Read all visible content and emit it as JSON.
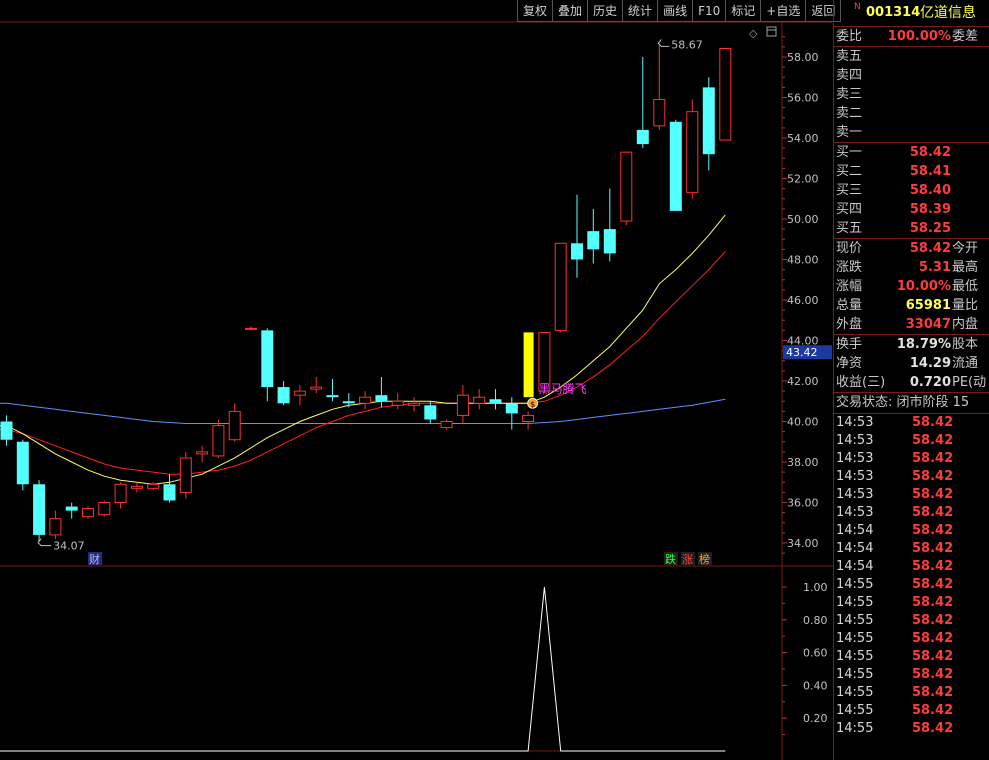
{
  "toolbar": {
    "buttons": [
      "复权",
      "叠加",
      "历史",
      "统计",
      "画线",
      "F10",
      "标记",
      "+自选",
      "返回"
    ]
  },
  "stock": {
    "code": "001314",
    "name": "亿道信息",
    "badge": "N"
  },
  "quote": {
    "weibi_label": "委比",
    "weibi_value": "100.00%",
    "weicha_label": "委差",
    "sell": [
      {
        "label": "卖五",
        "price": ""
      },
      {
        "label": "卖四",
        "price": ""
      },
      {
        "label": "卖三",
        "price": ""
      },
      {
        "label": "卖二",
        "price": ""
      },
      {
        "label": "卖一",
        "price": ""
      }
    ],
    "buy": [
      {
        "label": "买一",
        "price": "58.42"
      },
      {
        "label": "买二",
        "price": "58.41"
      },
      {
        "label": "买三",
        "price": "58.40"
      },
      {
        "label": "买四",
        "price": "58.39"
      },
      {
        "label": "买五",
        "price": "58.25"
      }
    ],
    "stats1": [
      {
        "label": "现价",
        "value": "58.42",
        "label2": "今开",
        "color": "red"
      },
      {
        "label": "涨跌",
        "value": "5.31",
        "label2": "最高",
        "color": "red"
      },
      {
        "label": "涨幅",
        "value": "10.00%",
        "label2": "最低",
        "color": "red"
      },
      {
        "label": "总量",
        "value": "65981",
        "label2": "量比",
        "color": "yellow"
      },
      {
        "label": "外盘",
        "value": "33047",
        "label2": "内盘",
        "color": "red"
      }
    ],
    "stats2": [
      {
        "label": "换手",
        "value": "18.79%",
        "label2": "股本",
        "color": "white"
      },
      {
        "label": "净资",
        "value": "14.29",
        "label2": "流通",
        "color": "white"
      },
      {
        "label": "收益(三)",
        "value": "0.720",
        "label2": "PE(动",
        "color": "white"
      }
    ],
    "trade_status": "交易状态: 闭市阶段 15"
  },
  "ticks": [
    {
      "time": "14:53",
      "price": "58.42"
    },
    {
      "time": "14:53",
      "price": "58.42"
    },
    {
      "time": "14:53",
      "price": "58.42"
    },
    {
      "time": "14:53",
      "price": "58.42"
    },
    {
      "time": "14:53",
      "price": "58.42"
    },
    {
      "time": "14:53",
      "price": "58.42"
    },
    {
      "time": "14:54",
      "price": "58.42"
    },
    {
      "time": "14:54",
      "price": "58.42"
    },
    {
      "time": "14:54",
      "price": "58.42"
    },
    {
      "time": "14:55",
      "price": "58.42"
    },
    {
      "time": "14:55",
      "price": "58.42"
    },
    {
      "time": "14:55",
      "price": "58.42"
    },
    {
      "time": "14:55",
      "price": "58.42"
    },
    {
      "time": "14:55",
      "price": "58.42"
    },
    {
      "time": "14:55",
      "price": "58.42"
    },
    {
      "time": "14:55",
      "price": "58.42"
    },
    {
      "time": "14:55",
      "price": "58.42"
    },
    {
      "time": "14:55",
      "price": "58.42"
    }
  ],
  "chart_data": {
    "type": "candlestick",
    "ylim": [
      33.0,
      59.5
    ],
    "y_ticks": [
      "58.00",
      "56.00",
      "54.00",
      "52.00",
      "50.00",
      "48.00",
      "46.00",
      "44.00",
      "42.00",
      "40.00",
      "38.00",
      "36.00",
      "34.00"
    ],
    "current_price_tag": "43.42",
    "high_marker": "58.67",
    "low_marker": "34.07",
    "signal_label": "黑马腾飞",
    "signal_coin": "$",
    "tags": {
      "left": "财",
      "right": [
        "跌",
        "涨",
        "榜"
      ]
    },
    "colors": {
      "up": "#ff3030",
      "down": "#54ffff",
      "ma_short": "#ffff60",
      "ma_mid": "#ff2020",
      "ma_long": "#6090ff",
      "signal": "#ffff00",
      "indicator": "#ffffff"
    },
    "candles": [
      {
        "o": 40.0,
        "h": 40.3,
        "l": 38.8,
        "c": 39.1
      },
      {
        "o": 39.0,
        "h": 39.1,
        "l": 36.6,
        "c": 36.9
      },
      {
        "o": 36.9,
        "h": 37.1,
        "l": 34.07,
        "c": 34.4
      },
      {
        "o": 34.4,
        "h": 35.6,
        "l": 34.2,
        "c": 35.2
      },
      {
        "o": 35.8,
        "h": 36.0,
        "l": 35.2,
        "c": 35.6
      },
      {
        "o": 35.3,
        "h": 35.8,
        "l": 35.2,
        "c": 35.7
      },
      {
        "o": 35.4,
        "h": 36.1,
        "l": 35.3,
        "c": 36.0
      },
      {
        "o": 36.0,
        "h": 37.0,
        "l": 35.7,
        "c": 36.9
      },
      {
        "o": 36.7,
        "h": 37.0,
        "l": 36.5,
        "c": 36.8
      },
      {
        "o": 36.7,
        "h": 37.0,
        "l": 36.6,
        "c": 36.9
      },
      {
        "o": 36.9,
        "h": 37.4,
        "l": 36.0,
        "c": 36.1
      },
      {
        "o": 36.5,
        "h": 38.5,
        "l": 36.2,
        "c": 38.2
      },
      {
        "o": 38.4,
        "h": 38.8,
        "l": 38.0,
        "c": 38.5
      },
      {
        "o": 38.3,
        "h": 40.1,
        "l": 38.2,
        "c": 39.8
      },
      {
        "o": 39.1,
        "h": 40.9,
        "l": 39.0,
        "c": 40.5
      },
      {
        "o": 44.6,
        "h": 44.7,
        "l": 44.5,
        "c": 44.6
      },
      {
        "o": 44.5,
        "h": 44.6,
        "l": 41.0,
        "c": 41.7
      },
      {
        "o": 41.7,
        "h": 42.0,
        "l": 40.8,
        "c": 40.9
      },
      {
        "o": 41.3,
        "h": 41.8,
        "l": 40.8,
        "c": 41.5
      },
      {
        "o": 41.6,
        "h": 42.2,
        "l": 41.4,
        "c": 41.7
      },
      {
        "o": 41.3,
        "h": 42.1,
        "l": 41.0,
        "c": 41.2
      },
      {
        "o": 41.0,
        "h": 41.4,
        "l": 40.7,
        "c": 40.9
      },
      {
        "o": 40.9,
        "h": 41.5,
        "l": 40.6,
        "c": 41.2
      },
      {
        "o": 41.3,
        "h": 42.2,
        "l": 40.7,
        "c": 41.0
      },
      {
        "o": 40.8,
        "h": 41.4,
        "l": 40.6,
        "c": 41.0
      },
      {
        "o": 40.8,
        "h": 41.2,
        "l": 40.5,
        "c": 40.9
      },
      {
        "o": 40.8,
        "h": 41.0,
        "l": 39.9,
        "c": 40.1
      },
      {
        "o": 39.7,
        "h": 40.1,
        "l": 39.6,
        "c": 40.0
      },
      {
        "o": 40.3,
        "h": 41.8,
        "l": 39.9,
        "c": 41.3
      },
      {
        "o": 40.9,
        "h": 41.6,
        "l": 40.6,
        "c": 41.2
      },
      {
        "o": 41.1,
        "h": 41.6,
        "l": 40.6,
        "c": 40.9
      },
      {
        "o": 40.9,
        "h": 41.2,
        "l": 39.6,
        "c": 40.4
      },
      {
        "o": 40.0,
        "h": 40.5,
        "l": 39.6,
        "c": 40.3
      },
      {
        "o": 41.5,
        "h": 44.4,
        "l": 41.4,
        "c": 44.4
      },
      {
        "o": 44.5,
        "h": 48.8,
        "l": 44.4,
        "c": 48.8
      },
      {
        "o": 48.8,
        "h": 51.2,
        "l": 47.1,
        "c": 48.0
      },
      {
        "o": 49.4,
        "h": 50.5,
        "l": 47.8,
        "c": 48.5
      },
      {
        "o": 49.5,
        "h": 51.5,
        "l": 47.9,
        "c": 48.3
      },
      {
        "o": 49.9,
        "h": 53.3,
        "l": 49.7,
        "c": 53.3
      },
      {
        "o": 54.4,
        "h": 58.0,
        "l": 53.5,
        "c": 53.7
      },
      {
        "o": 54.6,
        "h": 58.67,
        "l": 54.4,
        "c": 55.9
      },
      {
        "o": 54.8,
        "h": 54.9,
        "l": 50.4,
        "c": 50.4
      },
      {
        "o": 51.3,
        "h": 55.9,
        "l": 51.0,
        "c": 55.3
      },
      {
        "o": 56.5,
        "h": 57.0,
        "l": 52.4,
        "c": 53.2
      },
      {
        "o": 53.9,
        "h": 58.42,
        "l": 53.9,
        "c": 58.42
      }
    ],
    "ma_short": [
      39.8,
      39.4,
      38.9,
      38.4,
      38.0,
      37.6,
      37.3,
      37.1,
      37.0,
      36.9,
      37.0,
      37.2,
      37.4,
      37.8,
      38.2,
      38.7,
      39.2,
      39.6,
      40.0,
      40.3,
      40.6,
      40.8,
      40.9,
      41.0,
      41.0,
      41.0,
      41.0,
      40.9,
      40.9,
      40.9,
      40.9,
      40.9,
      40.9,
      41.2,
      41.7,
      42.3,
      43.0,
      43.7,
      44.6,
      45.5,
      46.8,
      47.5,
      48.3,
      49.2,
      50.2
    ],
    "ma_mid": [
      39.6,
      39.4,
      39.1,
      38.8,
      38.5,
      38.2,
      37.9,
      37.7,
      37.6,
      37.5,
      37.4,
      37.4,
      37.5,
      37.6,
      37.8,
      38.1,
      38.5,
      38.9,
      39.3,
      39.7,
      40.0,
      40.3,
      40.5,
      40.7,
      40.8,
      40.9,
      40.9,
      40.9,
      40.9,
      40.9,
      40.9,
      40.9,
      40.9,
      41.0,
      41.3,
      41.7,
      42.2,
      42.8,
      43.5,
      44.2,
      45.1,
      45.9,
      46.7,
      47.5,
      48.4
    ],
    "ma_long": [
      40.9,
      40.8,
      40.7,
      40.6,
      40.5,
      40.4,
      40.3,
      40.2,
      40.1,
      40.0,
      39.95,
      39.9,
      39.9,
      39.9,
      39.9,
      39.9,
      39.9,
      39.9,
      39.9,
      39.9,
      39.9,
      39.9,
      39.9,
      39.9,
      39.9,
      39.9,
      39.9,
      39.9,
      39.9,
      39.9,
      39.9,
      39.9,
      39.9,
      39.95,
      40.0,
      40.1,
      40.2,
      40.3,
      40.4,
      40.5,
      40.6,
      40.7,
      40.8,
      40.95,
      41.1
    ],
    "indicator": {
      "ylim": [
        0,
        1.1
      ],
      "y_ticks": [
        "1.00",
        "0.80",
        "0.60",
        "0.40",
        "0.20"
      ],
      "values": [
        0,
        0,
        0,
        0,
        0,
        0,
        0,
        0,
        0,
        0,
        0,
        0,
        0,
        0,
        0,
        0,
        0,
        0,
        0,
        0,
        0,
        0,
        0,
        0,
        0,
        0,
        0,
        0,
        0,
        0,
        0,
        0,
        0,
        1,
        0,
        0,
        0,
        0,
        0,
        0,
        0,
        0,
        0,
        0,
        0
      ]
    }
  }
}
